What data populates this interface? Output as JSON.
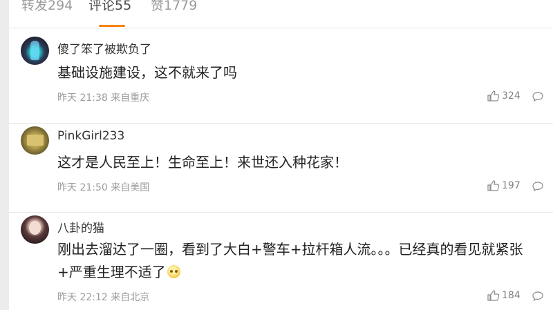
{
  "tabs": {
    "repost_label": "转发294",
    "comment_label": "评论55",
    "like_label": "赞1779"
  },
  "comments": [
    {
      "username": "傻了笨了被欺负了",
      "text": "基础设施建设，这不就来了吗",
      "meta": "昨天 21:38 来自重庆",
      "likes": "324"
    },
    {
      "username": "PinkGirl233",
      "text": "这才是人民至上！生命至上！来世还入种花家！",
      "meta": "昨天 21:50 来自美国",
      "likes": "197"
    },
    {
      "username": "八卦的猫",
      "text": "刚出去溜达了一圈，看到了大白+警车+拉杆箱人流。。。已经真的看见就紧张+严重生理不适了",
      "meta": "昨天 22:12 来自北京",
      "likes": "184"
    }
  ],
  "icons": {
    "like": "thumbs-up-icon",
    "reply": "comment-bubble-icon",
    "emoji": "worried-face-emoji-icon"
  },
  "colors": {
    "active_tab_underline": "#ff8200",
    "text": "#222222",
    "meta": "#9b9b9b"
  }
}
